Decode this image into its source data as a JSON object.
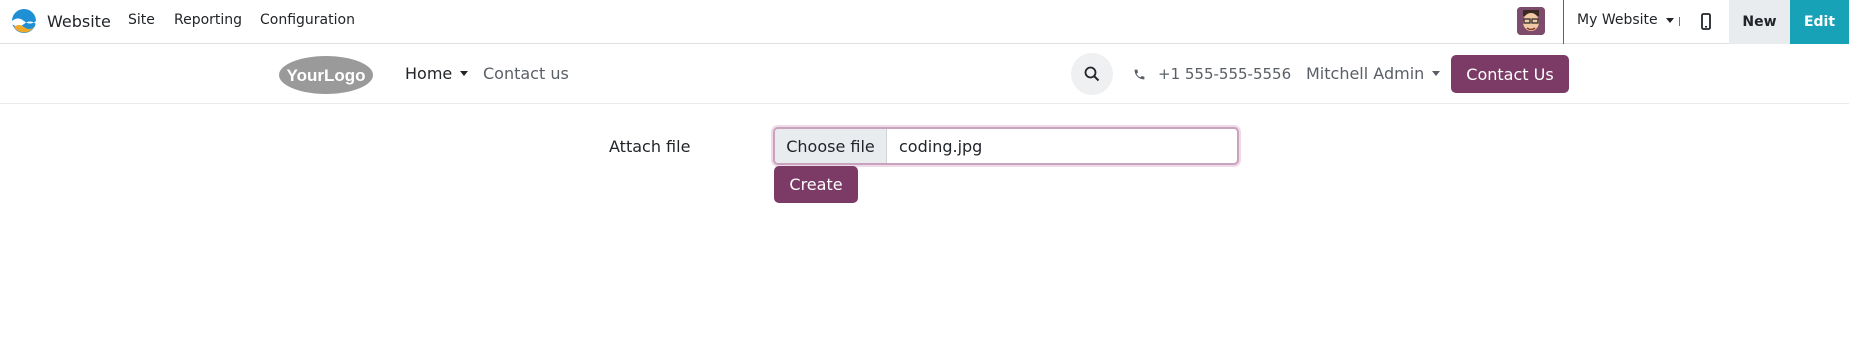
{
  "topbar": {
    "app_name": "Website",
    "menus": [
      "Site",
      "Reporting",
      "Configuration"
    ],
    "website_switcher": "My Website",
    "new_label": "New",
    "edit_label": "Edit",
    "brand_colors": [
      "#1f8fd6",
      "#f0a929"
    ],
    "edit_color": "#17a2b8"
  },
  "header": {
    "logo_text": "YourLogo",
    "nav": {
      "home": "Home",
      "contact": "Contact us"
    },
    "phone": "+1 555-555-5556",
    "user": "Mitchell Admin",
    "contact_button": "Contact Us",
    "accent_color": "#7b3b66"
  },
  "form": {
    "attach_label": "Attach file",
    "choose_file_label": "Choose file",
    "file_name": "coding.jpg",
    "create_label": "Create"
  }
}
